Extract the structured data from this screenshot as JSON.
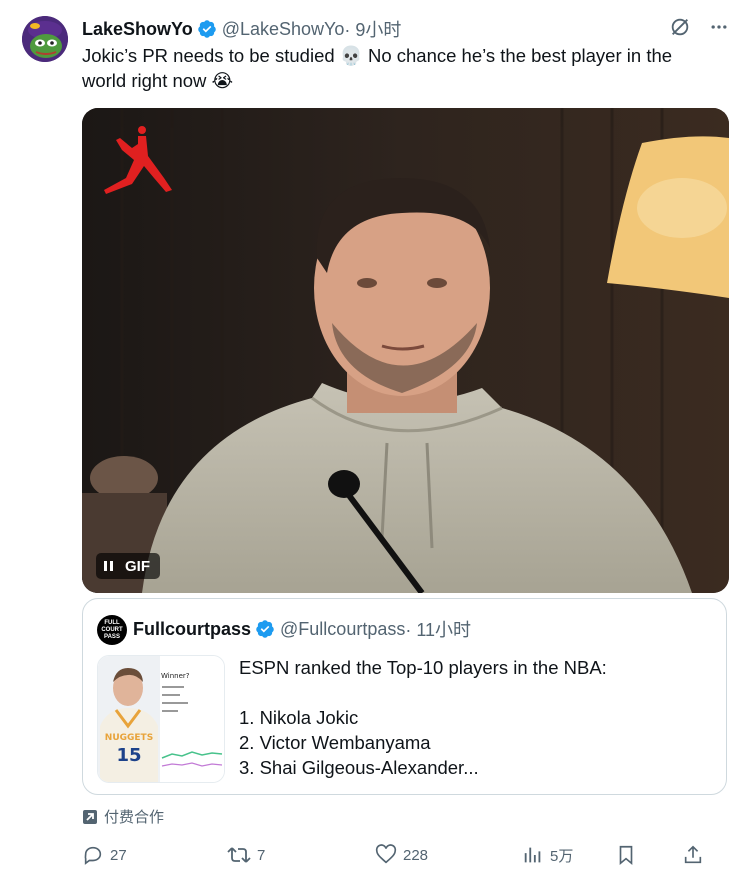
{
  "tweet": {
    "display_name": "LakeShowYo",
    "handle": "@LakeShowYo",
    "time": "· 9小时",
    "text_line1": "Jokic’s PR needs to be studied 💀 No chance he’s the best player in the",
    "text_line2": "world right now 😭"
  },
  "media": {
    "badge_label": "GIF"
  },
  "quote": {
    "display_name": "Fullcourtpass",
    "handle": "@Fullcourtpass",
    "time": "· 11小时",
    "avatar_text": "FULL COURT PASS",
    "lines": [
      "ESPN ranked the Top-10 players in the NBA:",
      "",
      "1. Nikola Jokic",
      "2. Victor Wembanyama",
      "3. Shai Gilgeous-Alexander..."
    ],
    "thumb": {
      "winner_label": "Winner?",
      "jersey_team": "NUGGETS",
      "jersey_number": "15"
    }
  },
  "paid_label": "付费合作",
  "actions": {
    "replies": "27",
    "retweets": "7",
    "likes": "228",
    "views": "5万"
  },
  "colors": {
    "verified": "#1d9bf0",
    "secondary_text": "#536471",
    "jordan_logo": "#e02020"
  }
}
